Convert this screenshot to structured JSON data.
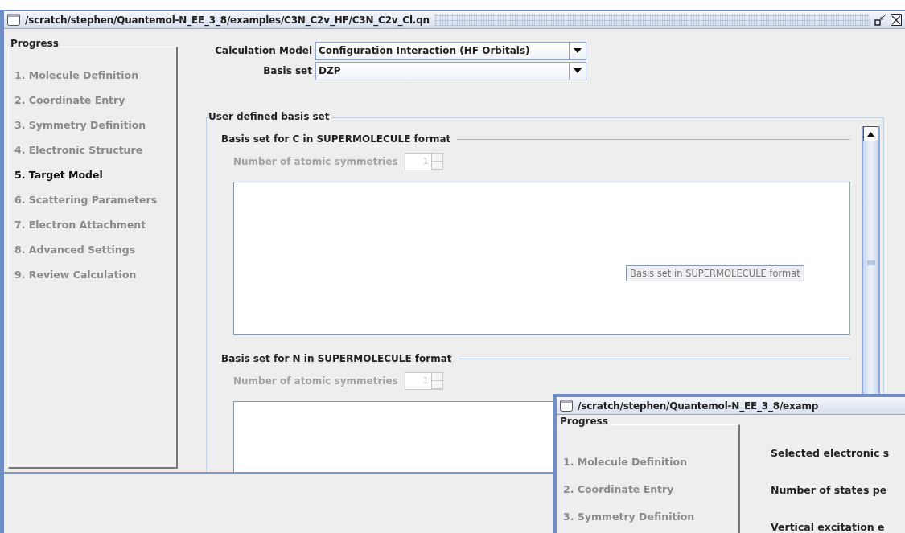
{
  "window": {
    "title": "/scratch/stephen/Quantemol-N_EE_3_8/examples/C3N_C2v_HF/C3N_C2v_Cl.qn"
  },
  "progress": {
    "title": "Progress",
    "steps": [
      {
        "label": "1. Molecule Definition",
        "selected": false
      },
      {
        "label": "2. Coordinate Entry",
        "selected": false
      },
      {
        "label": "3. Symmetry Definition",
        "selected": false
      },
      {
        "label": "4. Electronic Structure",
        "selected": false
      },
      {
        "label": "5. Target Model",
        "selected": true
      },
      {
        "label": "6. Scattering Parameters",
        "selected": false
      },
      {
        "label": "7. Electron Attachment",
        "selected": false
      },
      {
        "label": "8. Advanced Settings",
        "selected": false
      },
      {
        "label": "9. Review Calculation",
        "selected": false
      }
    ]
  },
  "calculation_model": {
    "label": "Calculation Model",
    "value": "Configuration Interaction (HF Orbitals)"
  },
  "basis_set": {
    "label": "Basis set",
    "value": "DZP"
  },
  "user_defined_basis_set": {
    "title": "User defined basis set",
    "atoms": [
      {
        "title": "Basis set for C in SUPERMOLECULE format",
        "symmetries_label": "Number of atomic symmetries",
        "symmetries_value": "1",
        "disabled": true
      },
      {
        "title": "Basis set for N in SUPERMOLECULE format",
        "symmetries_label": "Number of atomic symmetries",
        "symmetries_value": "1",
        "disabled": true
      }
    ]
  },
  "tooltip": "Basis set in SUPERMOLECULE format",
  "second_window": {
    "title": "/scratch/stephen/Quantemol-N_EE_3_8/examp",
    "progress": {
      "title": "Progress",
      "steps": [
        {
          "label": "1. Molecule Definition",
          "selected": false
        },
        {
          "label": "2. Coordinate Entry",
          "selected": false
        },
        {
          "label": "3. Symmetry Definition",
          "selected": false
        }
      ]
    },
    "labels": [
      "Selected electronic s",
      "Number of states pe",
      "Vertical excitation e"
    ]
  }
}
